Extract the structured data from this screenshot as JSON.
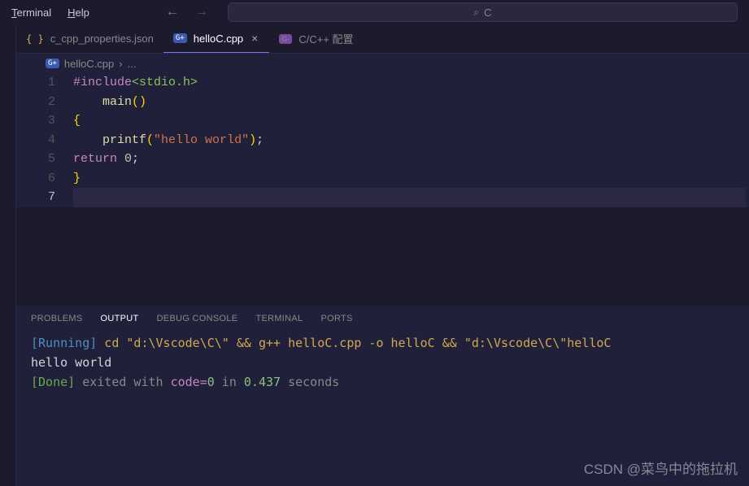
{
  "menubar": {
    "terminal_mnemonic": "T",
    "terminal_rest": "erminal",
    "help_mnemonic": "H",
    "help_rest": "elp"
  },
  "search": {
    "placeholder": "C"
  },
  "tabs": [
    {
      "icon": "json",
      "label": "c_cpp_properties.json",
      "active": false,
      "closable": false
    },
    {
      "icon": "cpp",
      "iconText": "G+",
      "label": "helloC.cpp",
      "active": true,
      "closable": true
    },
    {
      "icon": "conf",
      "iconText": "G·",
      "label": "C/C++ 配置",
      "active": false,
      "closable": false
    }
  ],
  "breadcrumb": {
    "iconText": "G+",
    "file": "helloC.cpp",
    "sep": "›",
    "more": "..."
  },
  "editor": {
    "activeLine": 7,
    "lines": [
      {
        "num": "1",
        "tokens": [
          {
            "t": "pp",
            "v": "#include"
          },
          {
            "t": "inc",
            "v": "<stdio.h>"
          }
        ]
      },
      {
        "num": "2",
        "tokens": [
          {
            "t": "plain",
            "v": "    "
          },
          {
            "t": "fn",
            "v": "main"
          },
          {
            "t": "brace",
            "v": "()"
          }
        ]
      },
      {
        "num": "3",
        "tokens": [
          {
            "t": "brace",
            "v": "{"
          }
        ]
      },
      {
        "num": "4",
        "tokens": [
          {
            "t": "plain",
            "v": "    "
          },
          {
            "t": "fn",
            "v": "printf"
          },
          {
            "t": "brace",
            "v": "("
          },
          {
            "t": "str",
            "v": "\"hello world\""
          },
          {
            "t": "brace",
            "v": ")"
          },
          {
            "t": "punct",
            "v": ";"
          }
        ]
      },
      {
        "num": "5",
        "tokens": [
          {
            "t": "kw",
            "v": "return"
          },
          {
            "t": "plain",
            "v": " "
          },
          {
            "t": "num",
            "v": "0"
          },
          {
            "t": "punct",
            "v": ";"
          }
        ]
      },
      {
        "num": "6",
        "tokens": [
          {
            "t": "brace",
            "v": "}"
          }
        ]
      },
      {
        "num": "7",
        "tokens": []
      }
    ]
  },
  "panel": {
    "tabs": [
      {
        "label": "PROBLEMS",
        "active": false
      },
      {
        "label": "OUTPUT",
        "active": true
      },
      {
        "label": "DEBUG CONSOLE",
        "active": false
      },
      {
        "label": "TERMINAL",
        "active": false
      },
      {
        "label": "PORTS",
        "active": false
      }
    ],
    "output": {
      "running_tag": "[Running]",
      "running_cmd": " cd \"d:\\Vscode\\C\\\" && g++ helloC.cpp -o helloC && \"d:\\Vscode\\C\\\"helloC",
      "stdout": "hello world",
      "done_tag": "[Done]",
      "done_t1": " exited with ",
      "done_code_key": "code=",
      "done_code_val": "0",
      "done_t2": " in ",
      "done_secs": "0.437",
      "done_t3": " seconds"
    }
  },
  "watermark": "CSDN @菜鸟中的拖拉机"
}
